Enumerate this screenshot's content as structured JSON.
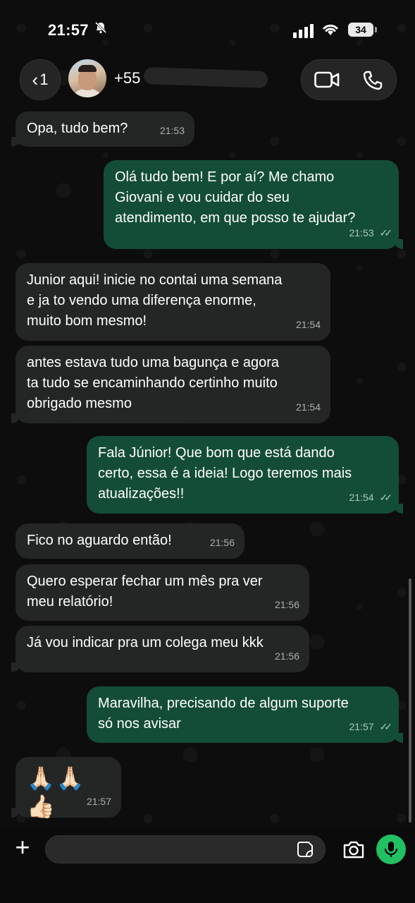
{
  "status_bar": {
    "time": "21:57",
    "battery": "34",
    "icons": [
      "bell-slash-icon",
      "signal-icon",
      "wifi-icon",
      "battery-icon"
    ]
  },
  "header": {
    "back_count": "1",
    "contact_name": "+55",
    "icons": [
      "chevron-left-icon",
      "video-call-icon",
      "phone-icon"
    ]
  },
  "messages": [
    {
      "dir": "in",
      "text": "Opa, tudo bem?",
      "time": "21:53"
    },
    {
      "dir": "out",
      "text": "Olá tudo bem! E por aí? Me chamo\nGiovani e vou cuidar do seu\natendimento, em que posso te ajudar?",
      "time": "21:53"
    },
    {
      "dir": "in",
      "text": "Junior aqui! inicie no contai uma semana\ne ja to vendo uma diferença enorme,\nmuito bom mesmo!",
      "time": "21:54"
    },
    {
      "dir": "in",
      "text": "antes estava tudo uma bagunça e agora\nta tudo se encaminhando certinho muito\nobrigado mesmo",
      "time": "21:54"
    },
    {
      "dir": "out",
      "text": "Fala Júnior! Que bom que está dando\ncerto, essa é a ideia! Logo teremos mais\natualizações!!",
      "time": "21:54"
    },
    {
      "dir": "in",
      "text": "Fico no aguardo então!",
      "time": "21:56"
    },
    {
      "dir": "in",
      "text": "Quero esperar fechar um mês pra ver\nmeu relatório!",
      "time": "21:56"
    },
    {
      "dir": "in",
      "text": "Já vou indicar pra um colega meu kkk",
      "time": "21:56"
    },
    {
      "dir": "out",
      "text": "Maravilha, precisando de algum suporte\nsó nos avisar",
      "time": "21:57"
    },
    {
      "dir": "in",
      "text": "🙏🏻🙏🏻👍🏻",
      "time": "21:57"
    }
  ],
  "composer": {
    "placeholder": "",
    "icons": [
      "plus-icon",
      "sticker-icon",
      "camera-icon",
      "microphone-icon"
    ],
    "mic_color": "#21c063"
  },
  "colors": {
    "incoming_bubble": "#242626",
    "outgoing_bubble": "#144d37",
    "background": "#0b0b0b"
  }
}
